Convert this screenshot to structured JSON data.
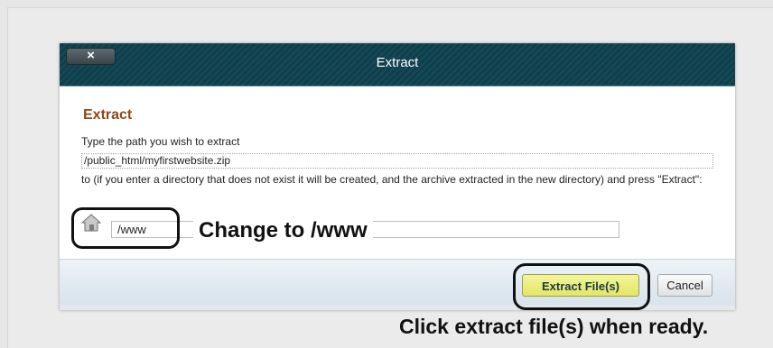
{
  "dialog": {
    "close_label": "×",
    "title": "Extract"
  },
  "content": {
    "section_title": "Extract",
    "prompt_label": "Type the path you wish to extract",
    "archive_path": "/public_html/myfirstwebsite.zip",
    "dest_help": "to (if you enter a directory that does not exist it will be created, and the archive extracted in the new directory) and press \"Extract\":",
    "dest_value": "/www",
    "home_icon": "home-icon"
  },
  "buttons": {
    "extract_label": "Extract File(s)",
    "cancel_label": "Cancel"
  },
  "annotations": {
    "change_note": "Change to /www",
    "click_note": "Click extract file(s) when ready."
  },
  "colors": {
    "titlebar": "#0d3f4d",
    "section_title": "#8c4a19",
    "extract_button": "#e8eb70"
  }
}
